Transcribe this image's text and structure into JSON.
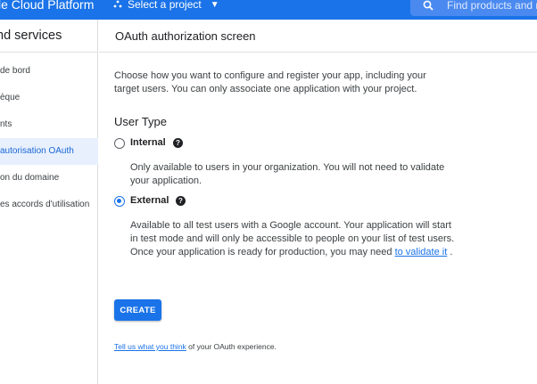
{
  "topbar": {
    "brand": "le Cloud Platform",
    "project_label": "Select a project",
    "search_placeholder": "Find products and re"
  },
  "sidebar": {
    "title": "nd services",
    "items": [
      {
        "label": "de bord",
        "active": false
      },
      {
        "label": "èque",
        "active": false
      },
      {
        "label": "nts",
        "active": false
      },
      {
        "label": "autorisation OAuth",
        "active": true
      },
      {
        "label": "on du domaine",
        "active": false
      },
      {
        "label": "es accords d'utilisation",
        "active": false
      }
    ]
  },
  "main": {
    "title": "OAuth authorization screen",
    "intro": "Choose how you want to configure and register your app, including your target users. You can only associate one application with your project.",
    "user_type_heading": "User Type",
    "options": {
      "internal": {
        "label": "Internal",
        "checked": false,
        "description": "Only available to users in your organization. You will not need to validate your application."
      },
      "external": {
        "label": "External",
        "checked": true,
        "description_pre": "Available to all test users with a Google account. Your application will start in test mode and will only be accessible to people on your list of test users. Once your application is ready for production, you may need",
        "description_link": "to validate it",
        "description_post": "."
      }
    },
    "create_label": "CREATE",
    "feedback_link": "Tell us what you think",
    "feedback_rest": " of your OAuth experience."
  },
  "colors": {
    "accent": "#1a73e8",
    "active_bg": "#e8f0fe"
  }
}
